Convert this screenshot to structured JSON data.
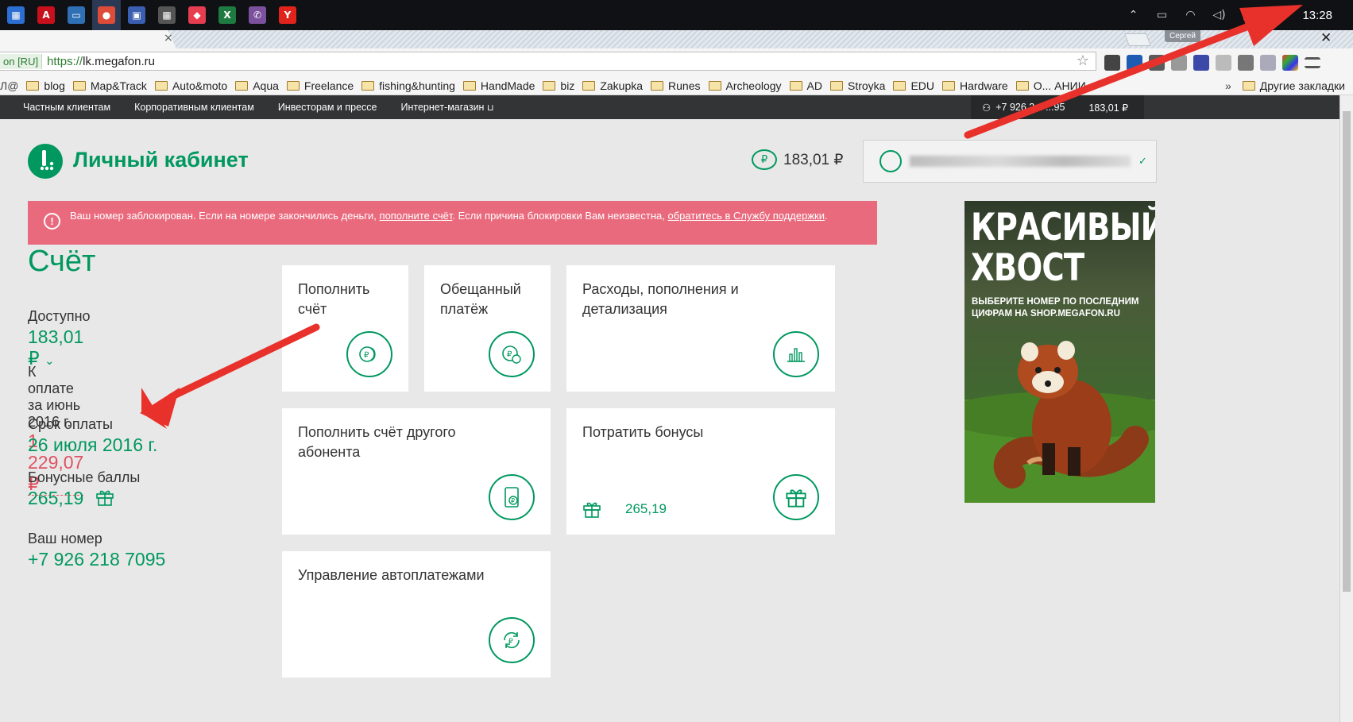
{
  "taskbar": {
    "apps": [
      {
        "name": "store-icon",
        "glyph": "▦",
        "color": "#2d6fd1"
      },
      {
        "name": "acrobat-icon",
        "glyph": "A",
        "color": "#c8101c"
      },
      {
        "name": "monitor-icon",
        "glyph": "▭",
        "color": "#2f6fb4"
      },
      {
        "name": "chrome-icon",
        "glyph": "●",
        "color": "#dd4b39"
      },
      {
        "name": "floppy-icon",
        "glyph": "▣",
        "color": "#3a5fb0"
      },
      {
        "name": "calculator-icon",
        "glyph": "▦",
        "color": "#555"
      },
      {
        "name": "pocket-icon",
        "glyph": "◆",
        "color": "#e63d50"
      },
      {
        "name": "excel-icon",
        "glyph": "X",
        "color": "#1f7a41"
      },
      {
        "name": "viber-icon",
        "glyph": "✆",
        "color": "#7b519d"
      },
      {
        "name": "yandex-icon",
        "glyph": "Y",
        "color": "#e0241c"
      }
    ],
    "clock": "13:28"
  },
  "browser": {
    "tab_close": "×",
    "user_badge": "Сергей",
    "window_close": "✕",
    "url_badge": "on [RU]",
    "url_scheme": "https://",
    "url_host": "lk.megafon.ru",
    "bookmark_lead": "Л@",
    "bookmarks": [
      "blog",
      "Map&Track",
      "Auto&moto",
      "Aqua",
      "Freelance",
      "fishing&hunting",
      "HandMade",
      "biz",
      "Zakupka",
      "Runes",
      "Archeology",
      "AD",
      "Stroyka",
      "EDU",
      "Hardware"
    ],
    "bookmark_truncated": "О... АНИИ",
    "more": "»",
    "other_bookmarks": "Другие закладки"
  },
  "site": {
    "nav": [
      "Частным клиентам",
      "Корпоративным клиентам",
      "Инвесторам и прессе",
      "Интернет-магазин"
    ],
    "cart_icon": "🛒",
    "nav_phone": "+7 926 2... ...95",
    "nav_balance": "183,01 ₽",
    "title": "Личный кабинет",
    "header_balance": "183,01 ₽",
    "alert": {
      "part1": "Ваш номер заблокирован. Если на номере закончились деньги, ",
      "link1": "пополните счёт",
      "part2": ". Если причина блокировки Вам неизвестна, ",
      "link2": "обратитесь в Службу поддержки",
      "part3": "."
    },
    "account": {
      "title": "Счёт",
      "available_label": "Доступно",
      "available_value": "183,01 ₽",
      "due_label": "К оплате за июнь 2016 г.",
      "due_value": "1 229,07 ₽",
      "deadline_label": "Срок оплаты",
      "deadline_value": "26 июля 2016 г.",
      "bonus_label": "Бонусные баллы",
      "bonus_value": "265,19",
      "number_label": "Ваш номер",
      "number_value": "+7 926 218 7095"
    },
    "cards": {
      "topup": "Пополнить счёт",
      "promised": "Обещанный платёж",
      "expenses": "Расходы, пополнения и детализация",
      "topup_other": "Пополнить счёт другого абонента",
      "bonuses": "Потратить бонусы",
      "bonuses_value": "265,19",
      "autopay": "Управление автоплатежами"
    },
    "ad": {
      "headline": "КРАСИВЫЙ ХВОСТ",
      "sub": "ВЫБЕРИТЕ НОМЕР ПО ПОСЛЕДНИМ ЦИФРАМ НА SHOP.MEGAFON.RU"
    }
  },
  "colors": {
    "brand_green": "#00985f",
    "alert_red": "#ea6a7d",
    "debt_red": "#e05262",
    "annotation_arrow": "#e8312b"
  }
}
